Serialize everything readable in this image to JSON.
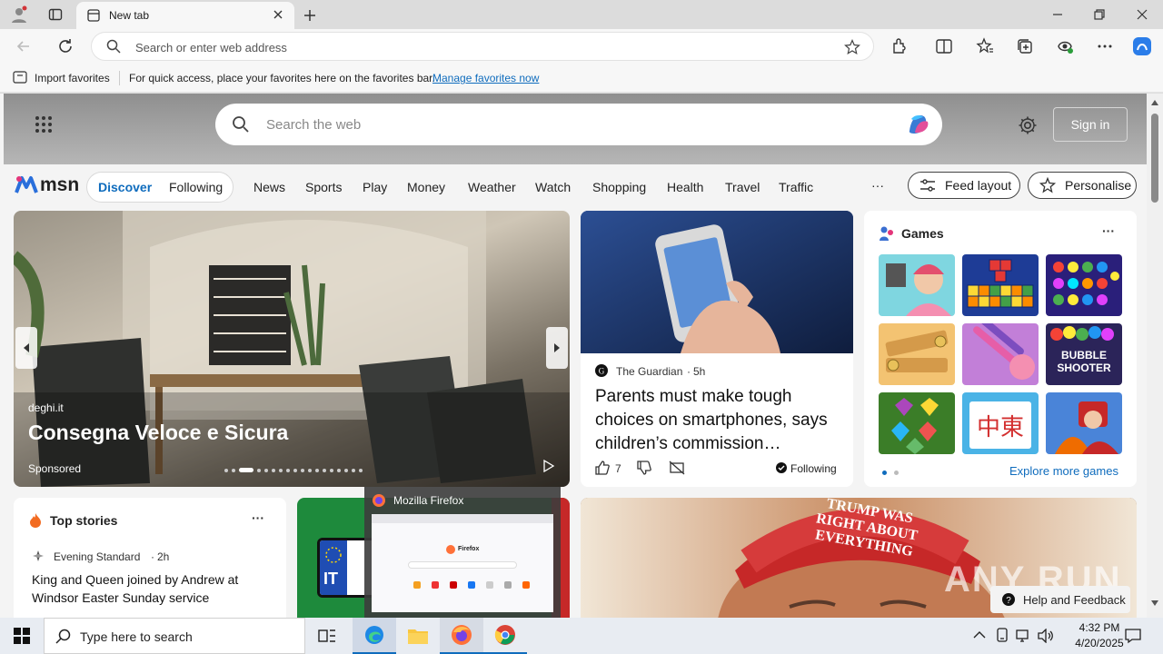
{
  "browser": {
    "tab_title": "New tab",
    "address_placeholder": "Search or enter web address",
    "favbar": {
      "import_label": "Import favorites",
      "message": "For quick access, place your favorites here on the favorites bar.",
      "manage_link": "Manage favorites now"
    }
  },
  "msn": {
    "search_placeholder": "Search the web",
    "sign_in": "Sign in",
    "logo_text": "msn",
    "tabs": [
      "Discover",
      "Following"
    ],
    "nav": [
      "News",
      "Sports",
      "Play",
      "Money",
      "Weather",
      "Watch",
      "Shopping",
      "Health",
      "Travel",
      "Traffic"
    ],
    "more": "···",
    "feed_layout": "Feed layout",
    "personalise": "Personalise"
  },
  "hero": {
    "source": "deghi.it",
    "title": "Consegna Veloce e Sicura",
    "sponsored": "Sponsored"
  },
  "news_card": {
    "source": "The Guardian",
    "age": "5h",
    "headline": "Parents must make tough choices on smartphones, says children’s commission…",
    "likes": "7",
    "following": "Following"
  },
  "games": {
    "title": "Games",
    "more": "···",
    "explore": "Explore more games",
    "tile_labels": [
      "",
      "",
      "",
      "",
      "",
      "BUBBLE SHOOTER",
      "",
      "中東",
      ""
    ],
    "tile_colors": [
      "#7fd6e0",
      "#1e3c96",
      "#2a1f7a",
      "#f3c372",
      "#c27fd8",
      "#2b2459",
      "#3b7d28",
      "#4ab3e6",
      "#4a84d8"
    ]
  },
  "top_stories": {
    "title": "Top stories",
    "more": "···",
    "source": "Evening Standard",
    "age": "2h",
    "headline": "King and Queen joined by Andrew at Windsor Easter Sunday service"
  },
  "plate": {
    "text": "IT"
  },
  "trump_card": {
    "hat_text": "TRUMP WAS RIGHT ABOUT EVERYTHING"
  },
  "watermark": "ANY RUN",
  "help_feedback": "Help and Feedback",
  "firefox_preview": {
    "title": "Mozilla Firefox",
    "inner": "Firefox"
  },
  "taskbar": {
    "search_placeholder": "Type here to search",
    "time": "4:32 PM",
    "date": "4/20/2025"
  },
  "colors": {
    "accent": "#0f6cbd",
    "taskbar": "#e8ecf2"
  }
}
